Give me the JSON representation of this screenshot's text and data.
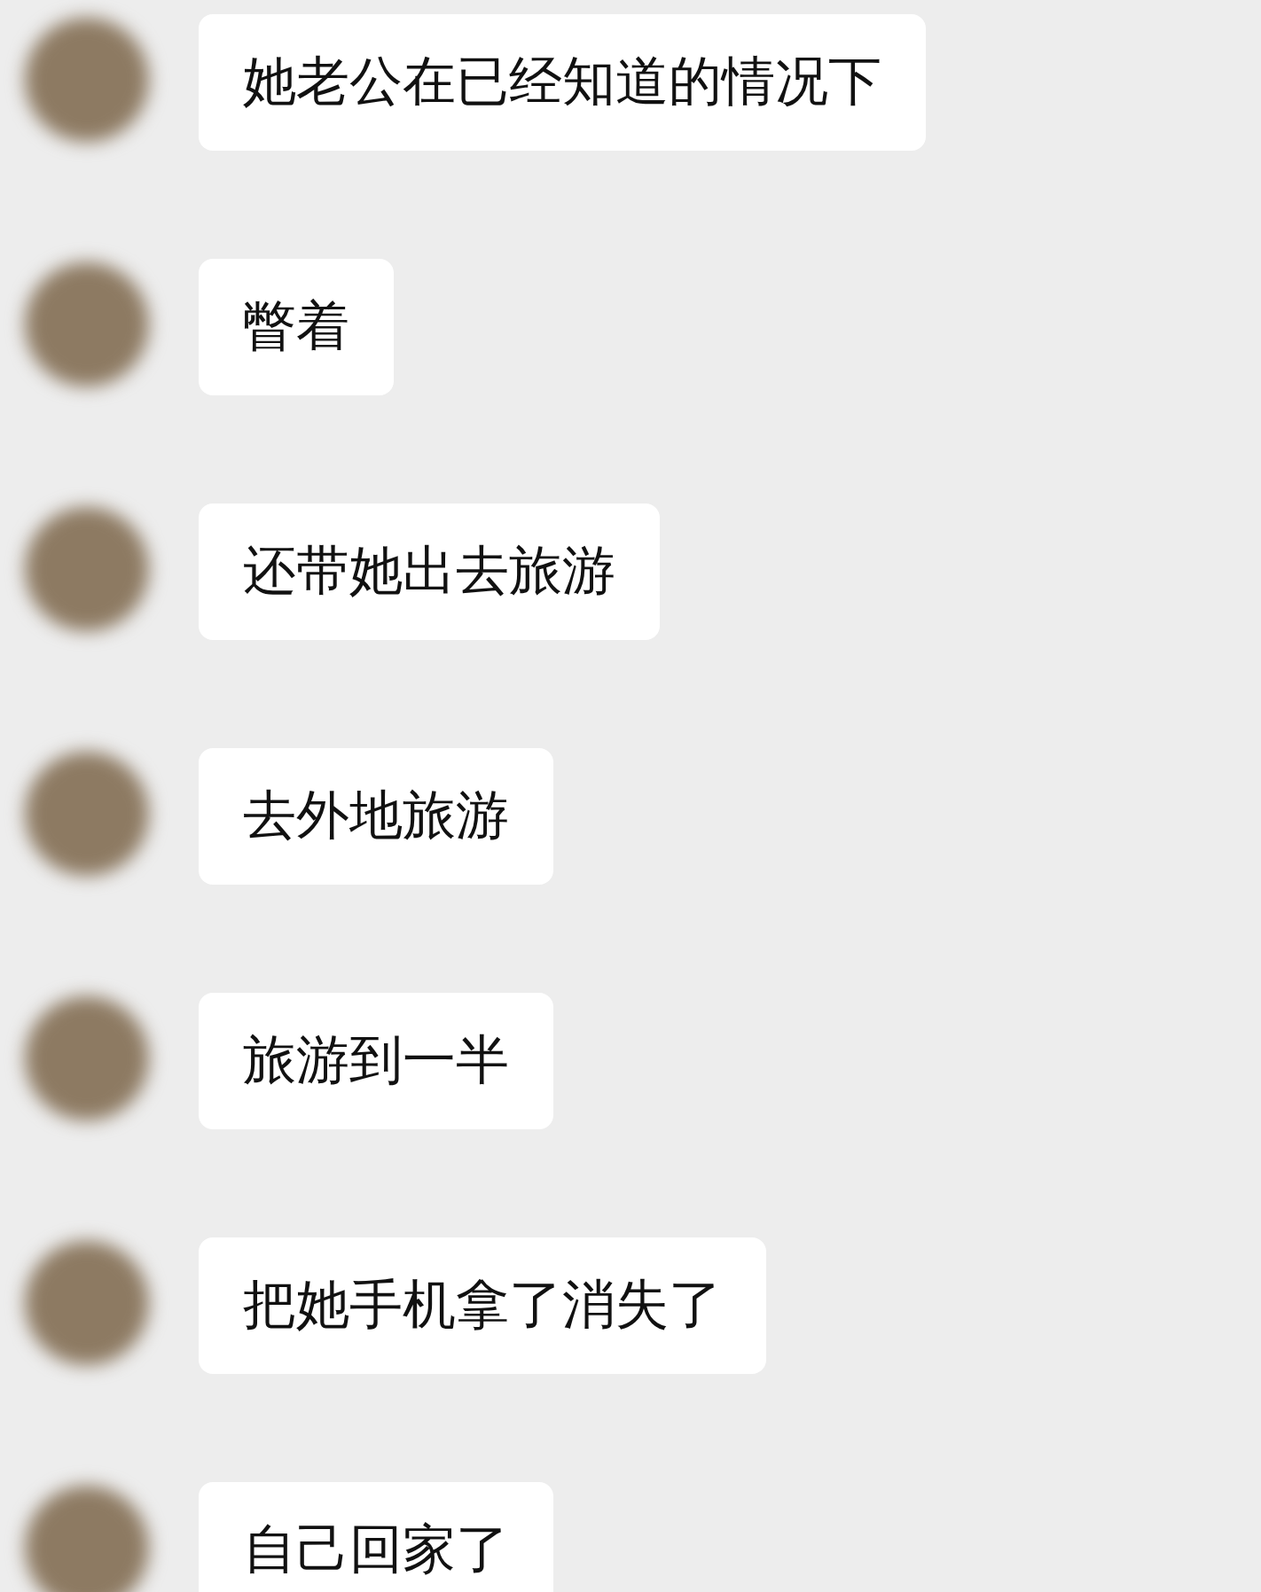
{
  "messages": [
    {
      "text": "她老公在已经知道的情况下"
    },
    {
      "text": "瞥着"
    },
    {
      "text": "还带她出去旅游"
    },
    {
      "text": "去外地旅游"
    },
    {
      "text": "旅游到一半"
    },
    {
      "text": "把她手机拿了消失了"
    },
    {
      "text": "自己回家了"
    }
  ]
}
